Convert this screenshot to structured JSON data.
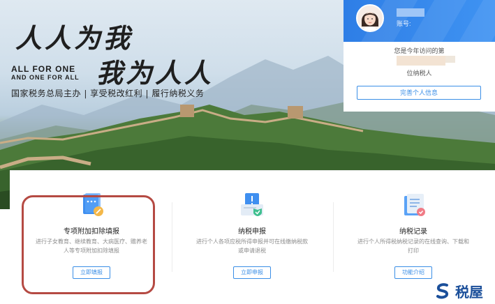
{
  "banner": {
    "slogan_cn_line1": "人人为我",
    "slogan_cn_line2": "我为人人",
    "slogan_en_line1": "ALL FOR ONE",
    "slogan_en_line2": "AND ONE FOR ALL",
    "tagline": "国家税务总局主办 | 享受税改红利 | 履行纳税义务"
  },
  "user_card": {
    "account_label": "账号:",
    "visit_text": "您是今年访问的第",
    "taxpayer_text": "位纳税人",
    "complete_button": "完善个人信息"
  },
  "services": [
    {
      "title": "专项附加扣除填报",
      "desc": "进行子女教育、继续教育、大病医疗、赡养老人等专项附加扣除填报",
      "button": "立即填报",
      "icon": "document-edit-icon"
    },
    {
      "title": "纳税申报",
      "desc": "进行个人各项应税所得申报并可在线缴纳税款或申请退税",
      "button": "立即申报",
      "icon": "tax-declaration-icon"
    },
    {
      "title": "纳税记录",
      "desc": "进行个人所得税纳税记录的在线查询、下载和打印",
      "button": "功能介绍",
      "icon": "tax-record-icon"
    }
  ],
  "watermark": {
    "text": "税屋"
  },
  "colors": {
    "accent": "#3a8ee6",
    "highlight": "#b54a43",
    "header_blue": "#2e7ee6"
  }
}
